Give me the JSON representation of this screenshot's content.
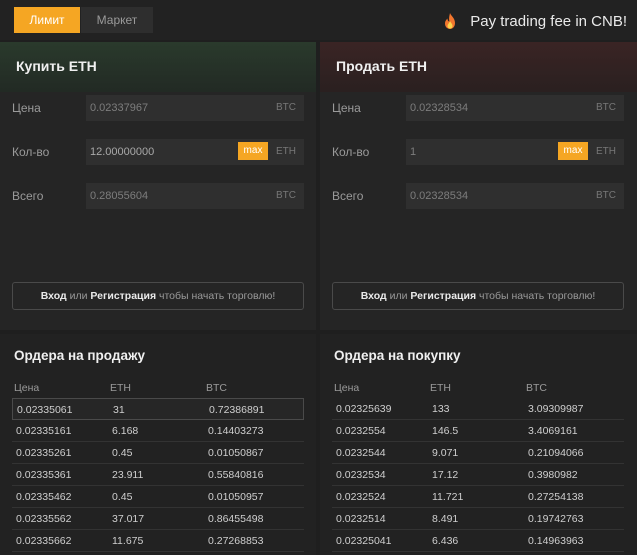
{
  "topbar": {
    "tab_limit": "Лимит",
    "tab_market": "Маркет",
    "fee_text": "Pay trading fee in CNB!"
  },
  "buy": {
    "title": "Купить ETH",
    "price_label": "Цена",
    "price_value": "0.02337967",
    "price_currency": "BTC",
    "amount_label": "Кол-во",
    "amount_value": "12.00000000",
    "amount_currency": "ETH",
    "max_label": "max",
    "total_label": "Всего",
    "total_value": "0.28055604",
    "total_currency": "BTC",
    "login_link": "Вход",
    "login_or": "или",
    "register_link": "Регистрация",
    "login_suffix": "чтобы начать торговлю!"
  },
  "sell": {
    "title": "Продать ETH",
    "price_label": "Цена",
    "price_value": "0.02328534",
    "price_currency": "BTC",
    "amount_label": "Кол-во",
    "amount_value": "1",
    "amount_currency": "ETH",
    "max_label": "max",
    "total_label": "Всего",
    "total_value": "0.02328534",
    "total_currency": "BTC",
    "login_link": "Вход",
    "login_or": "или",
    "register_link": "Регистрация",
    "login_suffix": "чтобы начать торговлю!"
  },
  "sell_orders": {
    "title": "Ордера на продажу",
    "columns": [
      "Цена",
      "ETH",
      "BTC"
    ],
    "rows": [
      [
        "0.02335061",
        "31",
        "0.72386891"
      ],
      [
        "0.02335161",
        "6.168",
        "0.14403273"
      ],
      [
        "0.02335261",
        "0.45",
        "0.01050867"
      ],
      [
        "0.02335361",
        "23.911",
        "0.55840816"
      ],
      [
        "0.02335462",
        "0.45",
        "0.01050957"
      ],
      [
        "0.02335562",
        "37.017",
        "0.86455498"
      ],
      [
        "0.02335662",
        "11.675",
        "0.27268853"
      ]
    ]
  },
  "buy_orders": {
    "title": "Ордера на покупку",
    "columns": [
      "Цена",
      "ETH",
      "BTC"
    ],
    "rows": [
      [
        "0.02325639",
        "133",
        "3.09309987"
      ],
      [
        "0.0232554",
        "146.5",
        "3.4069161"
      ],
      [
        "0.0232544",
        "9.071",
        "0.21094066"
      ],
      [
        "0.0232534",
        "17.12",
        "0.3980982"
      ],
      [
        "0.0232524",
        "11.721",
        "0.27254138"
      ],
      [
        "0.0232514",
        "8.491",
        "0.19742763"
      ],
      [
        "0.02325041",
        "6.436",
        "0.14963963"
      ]
    ]
  },
  "colors": {
    "accent": "#f5a623",
    "background": "#1f1f1f",
    "panel": "#252525"
  },
  "icons": {
    "fee_icon": "fire-icon"
  }
}
